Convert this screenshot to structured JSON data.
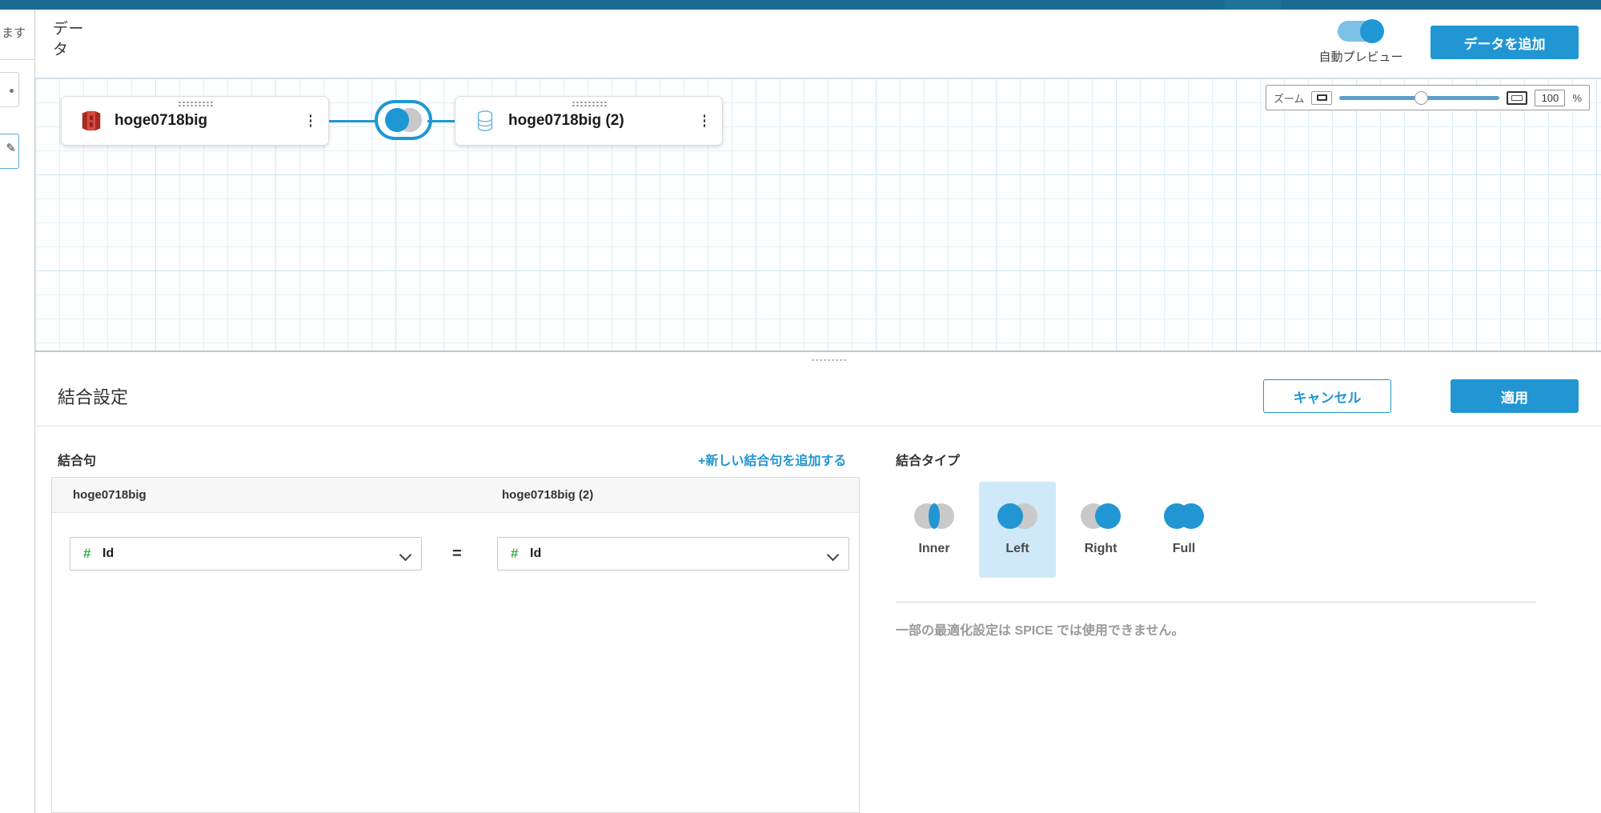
{
  "header": {
    "title": "データ",
    "auto_preview_label": "自動プレビュー",
    "auto_preview_on": true,
    "add_data_button": "データを追加"
  },
  "zoom_control": {
    "label": "ズーム",
    "fit_icon": "fit-screen-icon",
    "actual_size_icon": "actual-size-icon",
    "value": "100",
    "unit": "%"
  },
  "canvas": {
    "nodes": [
      {
        "label": "hoge0718big",
        "icon": "redshift-icon",
        "menu_icon": "kebab-menu-icon"
      },
      {
        "label": "hoge0718big (2)",
        "icon": "database-icon",
        "menu_icon": "kebab-menu-icon"
      }
    ],
    "join_node_icon": "left-join-venn-icon"
  },
  "panel": {
    "title": "結合設定",
    "cancel_button": "キャンセル",
    "apply_button": "適用",
    "clause_heading": "結合句",
    "add_clause_link": "+新しい結合句を追加する",
    "clause_table": {
      "columns": [
        "hoge0718big",
        "hoge0718big (2)"
      ],
      "rows": [
        {
          "left_field": "Id",
          "left_type": "#",
          "operator": "=",
          "right_field": "Id",
          "right_type": "#"
        }
      ]
    },
    "join_type": {
      "heading": "結合タイプ",
      "options": [
        {
          "label": "Inner",
          "icon": "inner-join-icon",
          "selected": false
        },
        {
          "label": "Left",
          "icon": "left-join-icon",
          "selected": true
        },
        {
          "label": "Right",
          "icon": "right-join-icon",
          "selected": false
        },
        {
          "label": "Full",
          "icon": "full-join-icon",
          "selected": false
        }
      ],
      "note": "一部の最適化設定は SPICE では使用できません。"
    }
  },
  "left_sidebar": {
    "clipped_text": "ます"
  },
  "colors": {
    "topbar": "#1a6c93",
    "accent": "#2196d3",
    "selected_bg": "#cfe9f8",
    "grid": "#dff0f7",
    "numeric_type": "#3fae49",
    "redshift_red": "#c8322a"
  }
}
